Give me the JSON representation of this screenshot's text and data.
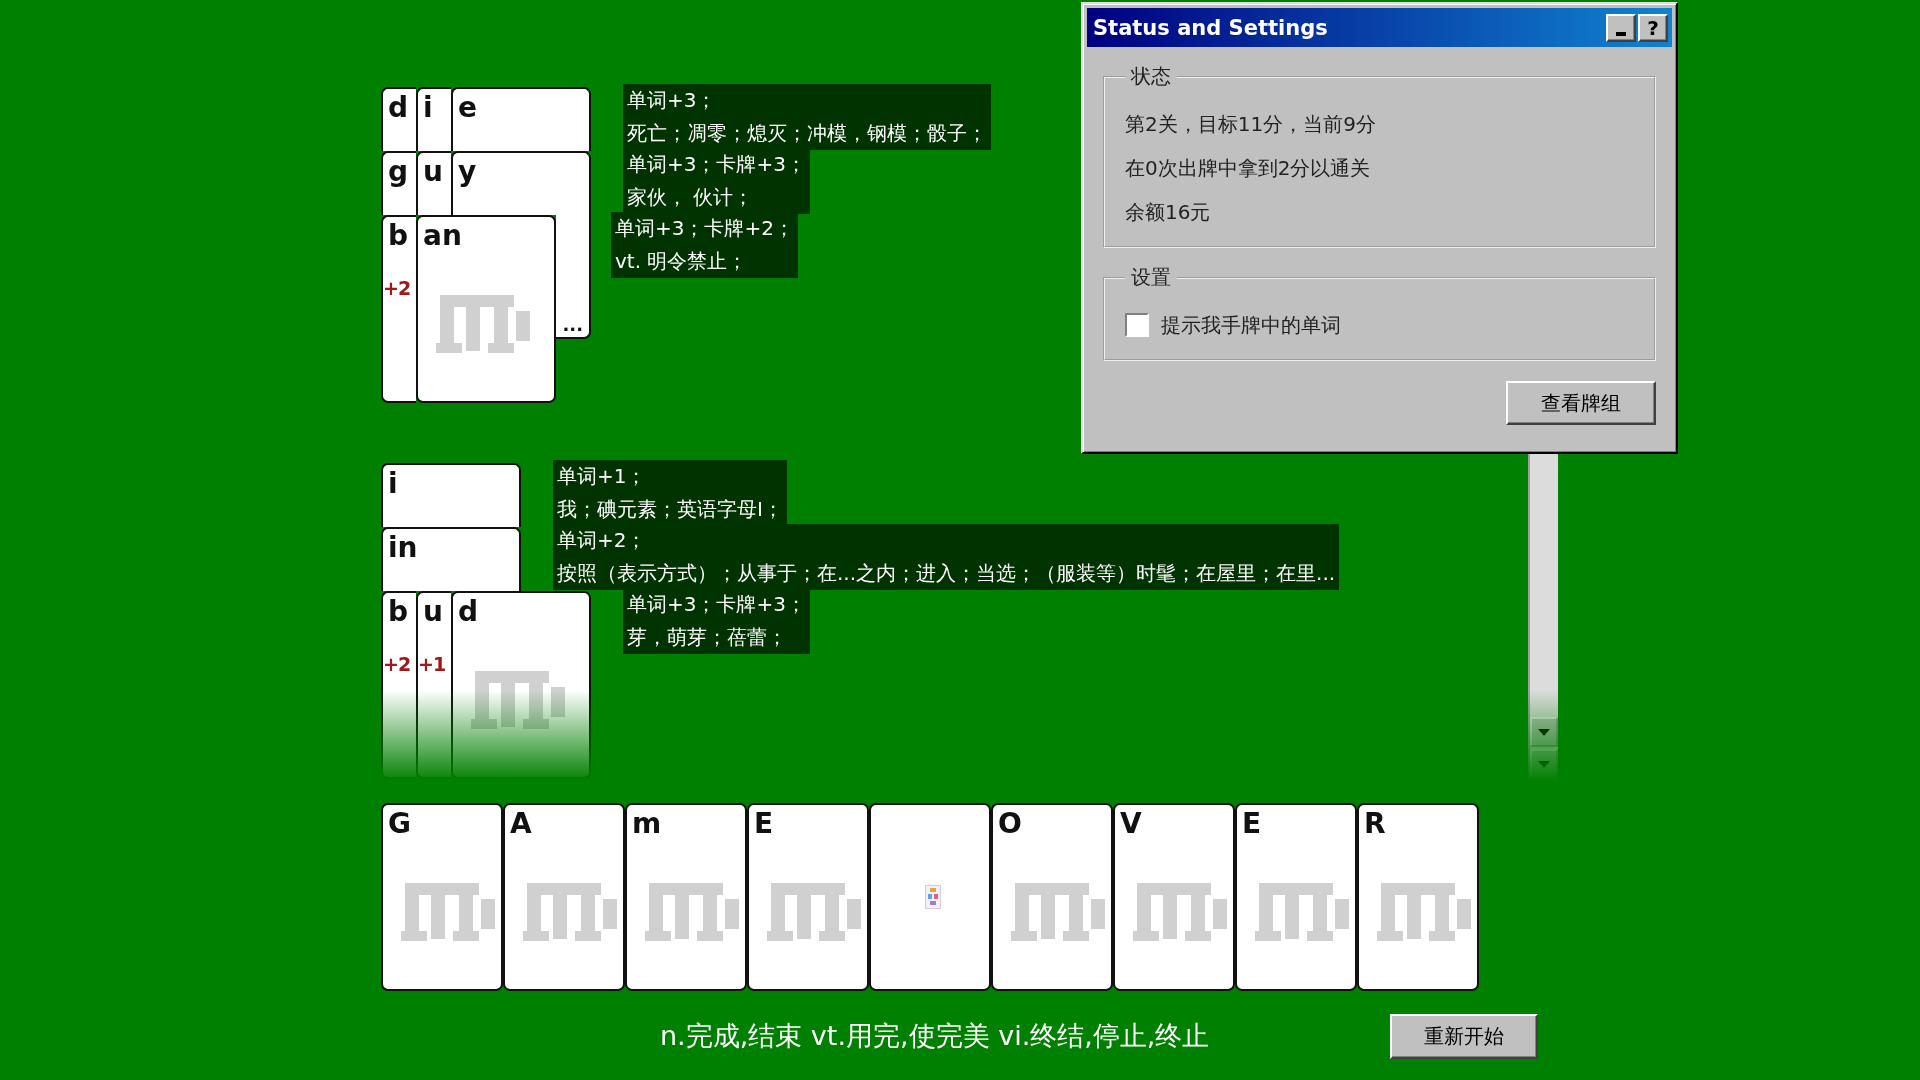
{
  "played_words": [
    {
      "cards": [
        {
          "letter": "d"
        },
        {
          "letter": "i"
        },
        {
          "letter": "e"
        }
      ],
      "score": "单词+3；",
      "definition": "死亡；凋零；熄灭；冲模，钢模；骰子；"
    },
    {
      "cards": [
        {
          "letter": "g"
        },
        {
          "letter": "u"
        },
        {
          "letter": "y",
          "footer": "..."
        }
      ],
      "score": "单词+3；卡牌+3；",
      "definition": "家伙， 伙计；"
    },
    {
      "cards": [
        {
          "letter": "b",
          "bonus": "+2"
        },
        {
          "letter": "an"
        }
      ],
      "score": "单词+3；卡牌+2；",
      "definition": "vt. 明令禁止；"
    }
  ],
  "current_words": [
    {
      "cards": [
        {
          "letter": "i"
        }
      ],
      "score": "单词+1；",
      "definition": "我；碘元素；英语字母I；"
    },
    {
      "cards": [
        {
          "letter": "in"
        }
      ],
      "score": "单词+2；",
      "definition": "按照（表示方式）；从事于；在...之内；进入；当选；（服装等）时髦；在屋里；在里..."
    },
    {
      "cards": [
        {
          "letter": "b",
          "bonus": "+2"
        },
        {
          "letter": "u",
          "bonus": "+1"
        },
        {
          "letter": "d"
        }
      ],
      "score": "单词+3；卡牌+3；",
      "definition": "芽，萌芽；蓓蕾；"
    }
  ],
  "hand": [
    {
      "kind": "letter",
      "letter": "G"
    },
    {
      "kind": "letter",
      "letter": "A"
    },
    {
      "kind": "letter",
      "letter": "m"
    },
    {
      "kind": "letter",
      "letter": "E"
    },
    {
      "kind": "blank"
    },
    {
      "kind": "letter",
      "letter": "O"
    },
    {
      "kind": "letter",
      "letter": "V"
    },
    {
      "kind": "letter",
      "letter": "E"
    },
    {
      "kind": "letter",
      "letter": "R"
    }
  ],
  "meaning": "n.完成,结束 vt.用完,使完美 vi.终结,停止,终止",
  "restart_button": "重新开始",
  "dialog": {
    "title": "Status and Settings",
    "help_button": "?",
    "status_group": {
      "title": "状态",
      "lines": [
        "第2关，目标11分，当前9分",
        "在0次出牌中拿到2分以通关",
        "余额16元"
      ]
    },
    "settings_group": {
      "title": "设置",
      "options": [
        {
          "label": "提示我手牌中的单词",
          "checked": false
        }
      ]
    },
    "deck_button": "查看牌组"
  }
}
